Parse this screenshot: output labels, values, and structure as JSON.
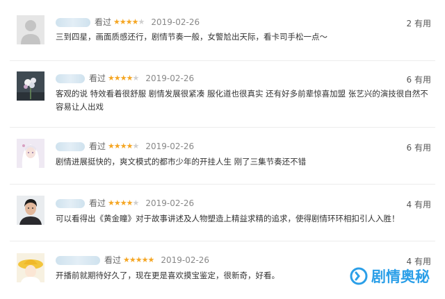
{
  "reviews": [
    {
      "watched": "看过",
      "stars": 4,
      "date": "2019-02-26",
      "useful": "2 有用",
      "text": "三到四星，画面质感还行，剧情节奏一般，女警尬出天际，看卡司手松一点～"
    },
    {
      "watched": "看过",
      "stars": 4,
      "date": "2019-02-26",
      "useful": "6 有用",
      "text": "客观的说 特效看着很舒服 剧情发展很紧凑 服化道也很真实 还有好多前辈惊喜加盟 张艺兴的演技很自然不容易让人出戏"
    },
    {
      "watched": "看过",
      "stars": 4,
      "date": "2019-02-26",
      "useful": "6 有用",
      "text": "剧情进展挺快的，爽文模式的都市少年的开挂人生 刚了三集节奏还不错"
    },
    {
      "watched": "看过",
      "stars": 4,
      "date": "2019-02-26",
      "useful": "4 有用",
      "text": "可以看得出《黄金瞳》对于故事讲述及人物塑造上精益求精的追求，使得剧情环环相扣引人入胜！"
    },
    {
      "watched": "看过",
      "stars": 5,
      "date": "2019-02-26",
      "useful": "4 有用",
      "text": "开播前就期待好久了，现在更是喜欢摸宝鉴定，很新奇，好看。"
    }
  ],
  "watermark": {
    "text": "剧情奥秘",
    "color": "#2b9fe8"
  },
  "colors": {
    "star": "#f5a623",
    "star_empty": "#cfcfcf",
    "blur": "#cfe2ee"
  },
  "icons": [
    "default-avatar-icon",
    "flower-avatar-icon",
    "anime-girl-avatar-icon",
    "man-portrait-avatar-icon",
    "yellow-hat-avatar-icon",
    "watermark-logo-icon"
  ]
}
